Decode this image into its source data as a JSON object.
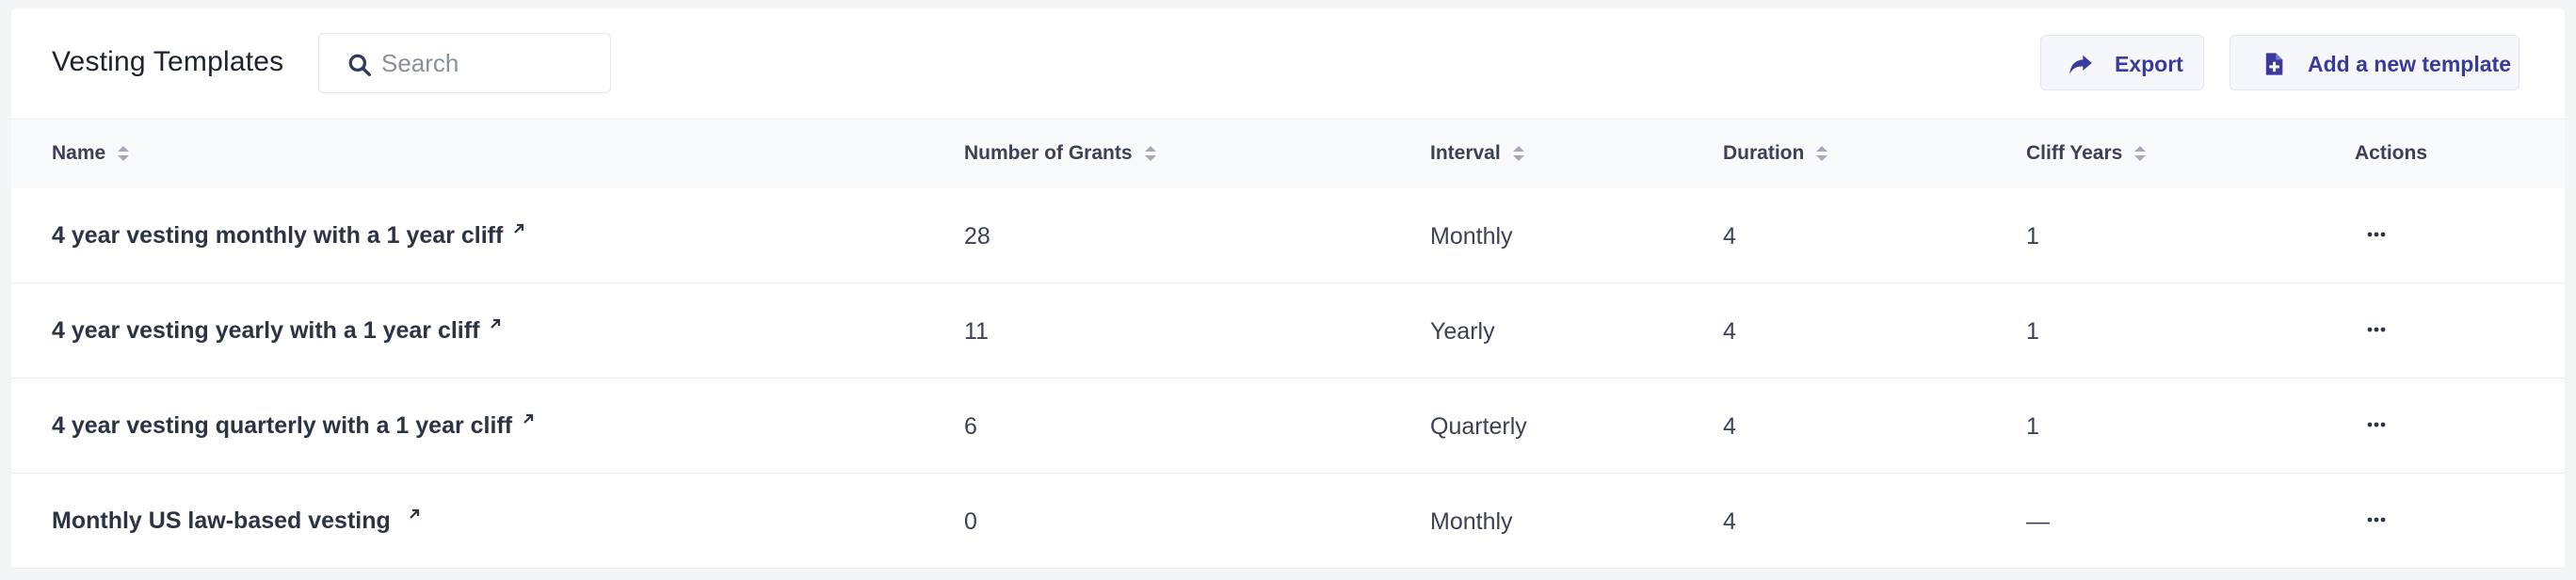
{
  "header": {
    "title": "Vesting Templates",
    "search_placeholder": "Search",
    "search_value": "",
    "export_label": "Export",
    "add_label": "Add a new template"
  },
  "columns": {
    "name": "Name",
    "grants": "Number of Grants",
    "interval": "Interval",
    "duration": "Duration",
    "cliff": "Cliff Years",
    "actions": "Actions"
  },
  "rows": [
    {
      "name": "4 year vesting monthly with a 1 year cliff",
      "grants": "28",
      "interval": "Monthly",
      "duration": "4",
      "cliff": "1"
    },
    {
      "name": "4 year vesting yearly with a 1 year cliff",
      "grants": "11",
      "interval": "Yearly",
      "duration": "4",
      "cliff": "1"
    },
    {
      "name": "4 year vesting quarterly with a 1 year cliff",
      "grants": "6",
      "interval": "Quarterly",
      "duration": "4",
      "cliff": "1"
    },
    {
      "name": "Monthly US law-based vesting",
      "grants": "0",
      "interval": "Monthly",
      "duration": "4",
      "cliff": "—"
    }
  ],
  "colors": {
    "accent": "#3a3a9c",
    "text": "#2c3444",
    "muted": "#8890a0"
  },
  "icons": {
    "search": "search-icon",
    "export": "share-arrow-icon",
    "add": "add-document-icon",
    "sort": "sort-icon",
    "external": "external-link-icon",
    "actions": "more-horizontal-icon"
  }
}
